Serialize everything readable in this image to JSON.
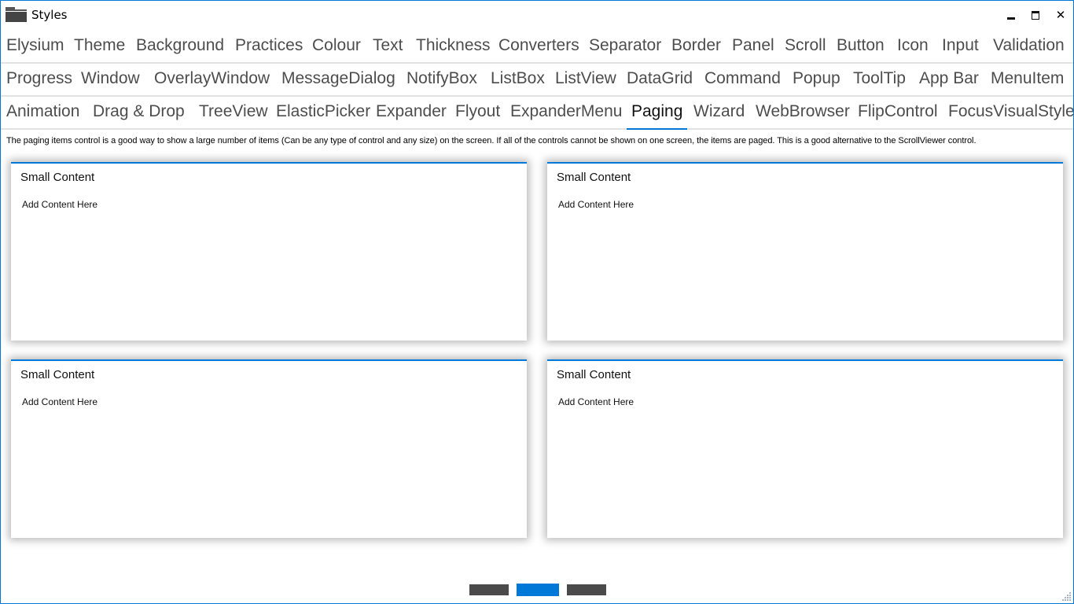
{
  "window": {
    "title": "Styles",
    "icon": "folder-icon",
    "controls": {
      "minimize": "minimize-icon",
      "maximize": "maximize-icon",
      "close": "close-icon"
    }
  },
  "tabs": {
    "rows": [
      [
        "Elysium",
        "Theme",
        "Background",
        "Practices",
        "Colour",
        "Text",
        "Thickness",
        "Converters",
        "Separator",
        "Border",
        "Panel",
        "Scroll",
        "Button",
        "Icon",
        "Input",
        "Validation"
      ],
      [
        "Progress",
        "Window",
        "OverlayWindow",
        "MessageDialog",
        "NotifyBox",
        "ListBox",
        "ListView",
        "DataGrid",
        "Command",
        "Popup",
        "ToolTip",
        "App Bar",
        "MenuItem"
      ],
      [
        "Animation",
        "Drag & Drop",
        "TreeView",
        "ElasticPicker",
        "Expander",
        "Flyout",
        "ExpanderMenu",
        "Paging",
        "Wizard",
        "WebBrowser",
        "FlipControl",
        "FocusVisualStyle"
      ]
    ],
    "selected": "Paging"
  },
  "description": "The paging items control is a good way to show a large number of items (Can be any type of control and any size) on the screen. If all of the controls cannot be shown on one screen, the items are paged. This is a good alternative to the ScrollViewer control.",
  "cards": [
    {
      "title": "Small Content",
      "body": "Add Content Here"
    },
    {
      "title": "Small Content",
      "body": "Add Content Here"
    },
    {
      "title": "Small Content",
      "body": "Add Content Here"
    },
    {
      "title": "Small Content",
      "body": "Add Content Here"
    }
  ],
  "pager": {
    "page_count": 3,
    "current_page": 2
  },
  "colors": {
    "accent": "#0078d7",
    "tab_text": "#4d4d4d",
    "pager_inactive": "#4a4a4a"
  }
}
